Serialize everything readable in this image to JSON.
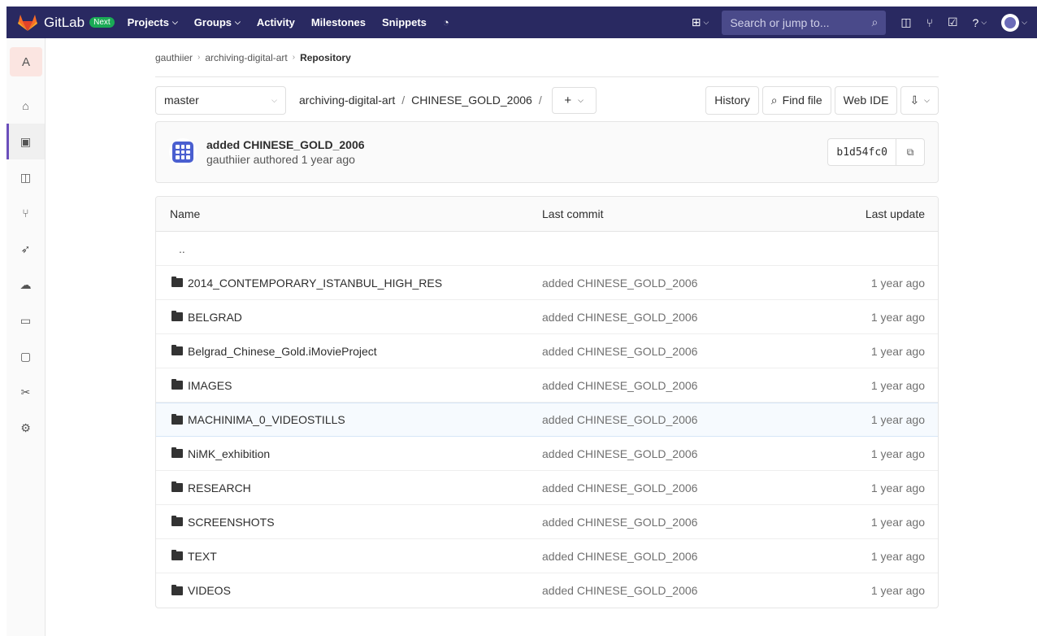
{
  "navbar": {
    "brand": "GitLab",
    "badge": "Next",
    "links": [
      {
        "label": "Projects",
        "dropdown": true
      },
      {
        "label": "Groups",
        "dropdown": true
      },
      {
        "label": "Activity",
        "dropdown": false
      },
      {
        "label": "Milestones",
        "dropdown": false
      },
      {
        "label": "Snippets",
        "dropdown": false
      }
    ],
    "search_placeholder": "Search or jump to...",
    "colors": {
      "background": "#292961",
      "badge": "#1aaa55"
    }
  },
  "sidebar": {
    "project_letter": "A",
    "items": [
      "home-icon",
      "repository-icon",
      "issues-icon",
      "merge-requests-icon",
      "ci-cd-icon",
      "operations-icon",
      "environments-icon",
      "wiki-icon",
      "snippets-icon",
      "settings-icon"
    ],
    "active": "repository-icon"
  },
  "breadcrumb": {
    "items": [
      "gauthiier",
      "archiving-digital-art",
      "Repository"
    ]
  },
  "controls": {
    "branch": "master",
    "path_project": "archiving-digital-art",
    "path_folder": "CHINESE_GOLD_2006",
    "add_label": "+",
    "history": "History",
    "find_file": "Find file",
    "web_ide": "Web IDE"
  },
  "commit": {
    "title": "added CHINESE_GOLD_2006",
    "meta": "gauthiier authored 1 year ago",
    "sha": "b1d54fc0"
  },
  "table": {
    "headers": {
      "name": "Name",
      "last_commit": "Last commit",
      "last_update": "Last update"
    },
    "parent": "..",
    "rows": [
      {
        "name": "2014_CONTEMPORARY_ISTANBUL_HIGH_RES",
        "commit": "added CHINESE_GOLD_2006",
        "updated": "1 year ago"
      },
      {
        "name": "BELGRAD",
        "commit": "added CHINESE_GOLD_2006",
        "updated": "1 year ago"
      },
      {
        "name": "Belgrad_Chinese_Gold.iMovieProject",
        "commit": "added CHINESE_GOLD_2006",
        "updated": "1 year ago"
      },
      {
        "name": "IMAGES",
        "commit": "added CHINESE_GOLD_2006",
        "updated": "1 year ago"
      },
      {
        "name": "MACHINIMA_0_VIDEOSTILLS",
        "commit": "added CHINESE_GOLD_2006",
        "updated": "1 year ago"
      },
      {
        "name": "NiMK_exhibition",
        "commit": "added CHINESE_GOLD_2006",
        "updated": "1 year ago"
      },
      {
        "name": "RESEARCH",
        "commit": "added CHINESE_GOLD_2006",
        "updated": "1 year ago"
      },
      {
        "name": "SCREENSHOTS",
        "commit": "added CHINESE_GOLD_2006",
        "updated": "1 year ago"
      },
      {
        "name": "TEXT",
        "commit": "added CHINESE_GOLD_2006",
        "updated": "1 year ago"
      },
      {
        "name": "VIDEOS",
        "commit": "added CHINESE_GOLD_2006",
        "updated": "1 year ago"
      }
    ]
  }
}
